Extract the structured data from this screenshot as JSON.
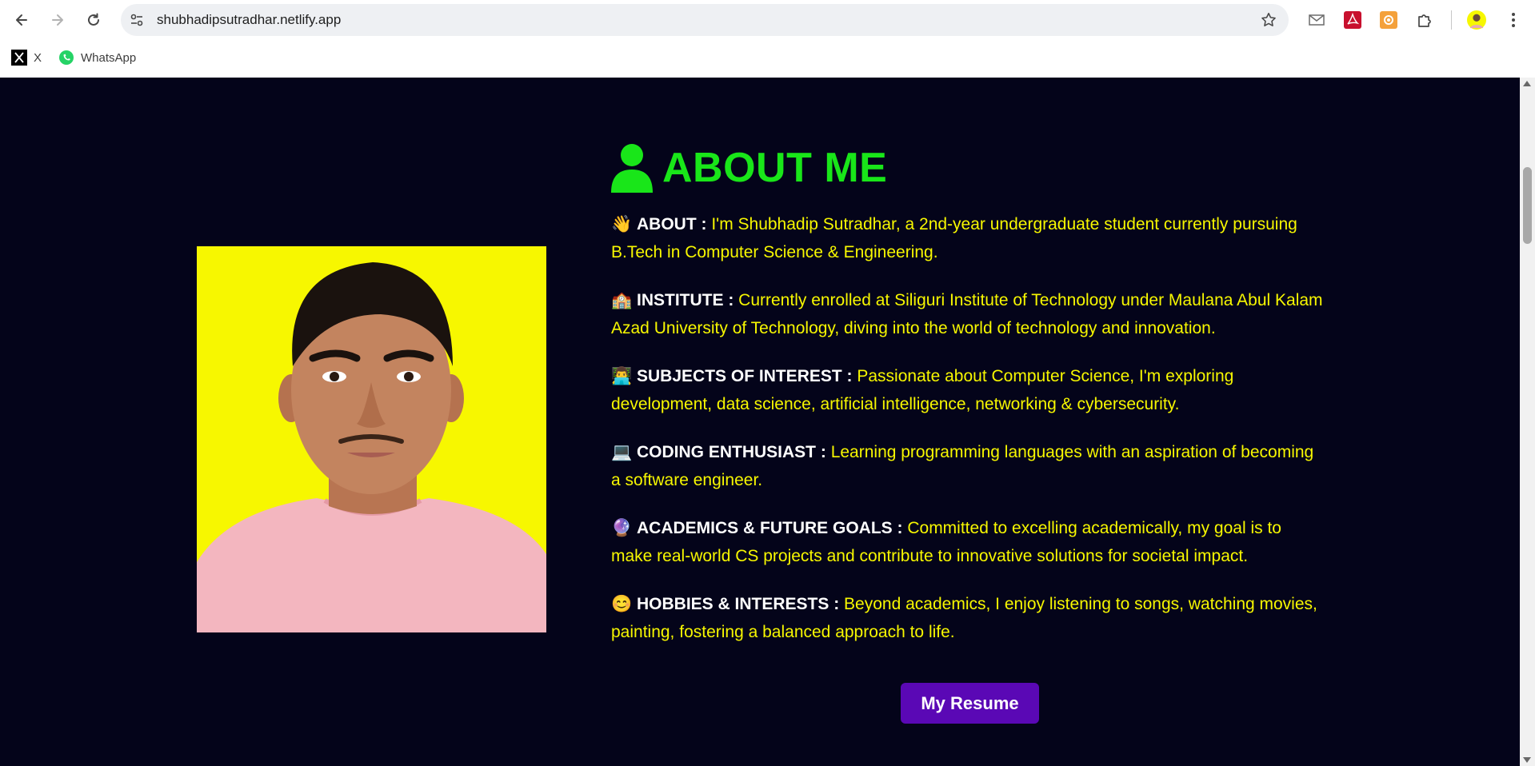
{
  "browser": {
    "url": "shubhadipsutradhar.netlify.app",
    "bookmarks": [
      {
        "label": "X",
        "icon": "x-logo-icon"
      },
      {
        "label": "WhatsApp",
        "icon": "whatsapp-icon"
      }
    ],
    "extensions": [
      "mail-icon",
      "pdf-icon",
      "camera-icon",
      "puzzle-icon"
    ]
  },
  "page": {
    "title": "ABOUT ME",
    "title_color": "#19e619",
    "text_color": "#f7f700",
    "background": "#04041a",
    "paragraphs": [
      {
        "emoji": "👋",
        "label": "ABOUT :",
        "text": "I'm Shubhadip Sutradhar, a 2nd-year undergraduate student currently pursuing B.Tech in Computer Science & Engineering."
      },
      {
        "emoji": "🏫",
        "label": "INSTITUTE :",
        "text": "Currently enrolled at Siliguri Institute of Technology under Maulana Abul Kalam Azad University of Technology, diving into the world of technology and innovation."
      },
      {
        "emoji": "👨‍💻",
        "label": "SUBJECTS OF INTEREST :",
        "text": "Passionate about Computer Science, I'm exploring development, data science, artificial intelligence, networking & cybersecurity."
      },
      {
        "emoji": "💻",
        "label": "CODING ENTHUSIAST :",
        "text": "Learning programming languages with an aspiration of becoming a software engineer."
      },
      {
        "emoji": "🔮",
        "label": "ACADEMICS & FUTURE GOALS :",
        "text": "Committed to excelling academically, my goal is to make real-world CS projects and contribute to innovative solutions for societal impact."
      },
      {
        "emoji": "😊",
        "label": "HOBBIES & INTERESTS :",
        "text": "Beyond academics, I enjoy listening to songs, watching movies, painting, fostering a balanced approach to life."
      }
    ],
    "resume_button": "My Resume",
    "resume_color": "#5a08b5"
  }
}
